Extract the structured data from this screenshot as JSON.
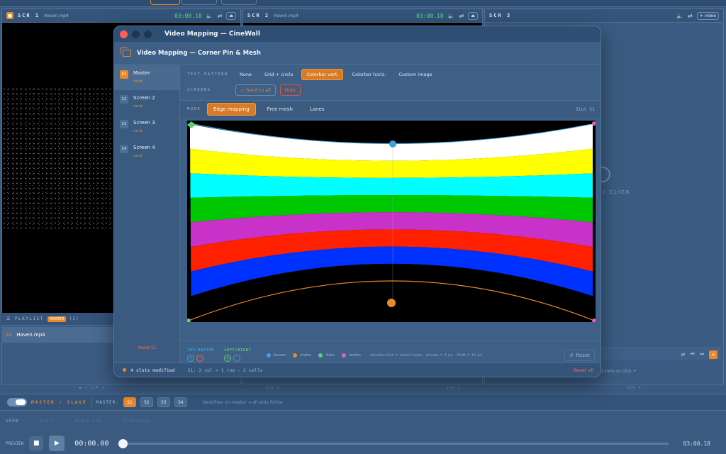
{
  "screens": [
    {
      "num": "1",
      "title": "SCR 1",
      "file": "Haven.mp4",
      "time": "03:00.18"
    },
    {
      "num": "2",
      "title": "SCR 2",
      "file": "Haven.mp4",
      "time": "03:00.18"
    },
    {
      "num": "3",
      "title": "SCR 3",
      "file": "",
      "time": "",
      "add_video": "+ video",
      "drop_text": "D / CLICK"
    }
  ],
  "playlist": {
    "label": "PLAYLIST",
    "badge": "MASTER",
    "count": "(1)",
    "item_index": "E5",
    "item_name": "Haven.mp4"
  },
  "screen_footers": [
    "● ○ SCR 1",
    "SCR 2",
    "SCR 3",
    "SCR 4"
  ],
  "right_panel": {
    "drop_text": "ls here or click +"
  },
  "master_slave": {
    "label": "MASTER / SLAVE",
    "master_label": "MASTER:",
    "slots": [
      "S1",
      "S2",
      "S3",
      "S4"
    ],
    "active": "S1",
    "note": "Next/Prev on master → all slots follow"
  },
  "show": {
    "label": "SHOW",
    "start": "Start",
    "blackout": "Black out",
    "fullscreen": "Fullscreen"
  },
  "preview": {
    "label": "PREVIEW",
    "time": "00:00.00",
    "end_time": "03:00.18",
    "progress": 0
  },
  "modal": {
    "window_title": "Video Mapping — CineWall",
    "header_title": "Video Mapping — Corner Pin & Mesh",
    "slots": [
      {
        "id": "S1",
        "name": "Master",
        "sub": "rand"
      },
      {
        "id": "S2",
        "name": "Screen 2",
        "sub": "rand"
      },
      {
        "id": "S3",
        "name": "Screen 3",
        "sub": "rand"
      },
      {
        "id": "S4",
        "name": "Screen 4",
        "sub": "rand"
      }
    ],
    "reset_slot": "Reset S1",
    "test_pattern_label": "TEST PATTERN",
    "test_patterns": [
      "None",
      "Grid + circle",
      "Colorbar vert.",
      "Colorbar horiz.",
      "Custom image"
    ],
    "active_pattern": "Colorbar vert.",
    "screens_label": "SCREENS",
    "send_to_all": "Send to all",
    "hide": "Hide",
    "mode_label": "MODE",
    "modes": [
      "Edge mapping",
      "Free mesh",
      "Lanes"
    ],
    "active_mode": "Edge mapping",
    "slot_label": "Slot S1",
    "edges": {
      "top_bottom": "TOP/BOTTOM",
      "left_right": "LEFT/RIGHT"
    },
    "legend": [
      {
        "name": "boven",
        "color": "#3aa3e0"
      },
      {
        "name": "onder",
        "color": "#e8892a"
      },
      {
        "name": "links",
        "color": "#5fd36b"
      },
      {
        "name": "rechts",
        "color": "#e85fb5"
      }
    ],
    "hint": "· double-click = switch type · arrows = 1 px · Shift = 10 px",
    "reset_btn": "Reset",
    "status_modified": "4 slots modified",
    "status_info": "S1: 2 col × 1 row — 2 cells",
    "reset_all": "Reset all",
    "colorbars": [
      "#ffffff",
      "#ffff00",
      "#00ffff",
      "#00c800",
      "#c832c8",
      "#ff2000",
      "#0032ff",
      "#000000"
    ]
  }
}
